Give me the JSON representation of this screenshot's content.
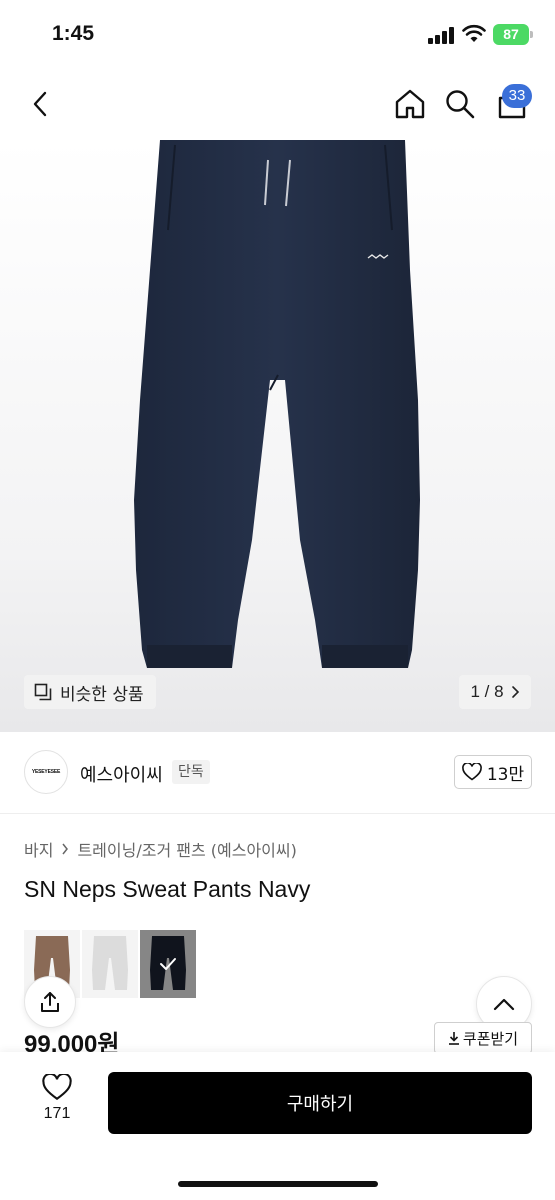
{
  "status_bar": {
    "time": "1:45",
    "battery": "87"
  },
  "nav": {
    "back_icon": "chevron-left-icon",
    "home_icon": "home-icon",
    "search_icon": "search-icon",
    "cart_icon": "shopping-bag-icon",
    "cart_count": "33"
  },
  "gallery": {
    "similar_label": "비슷한 상품",
    "pager": "1 / 8"
  },
  "brand": {
    "logo_text": "YESEYESEE",
    "name": "예스아이씨",
    "badge": "단독",
    "likes": "13만"
  },
  "breadcrumb": {
    "level1": "바지",
    "level2": "트레이닝/조거 팬츠 (예스아이씨)"
  },
  "product": {
    "title": "SN Neps Sweat Pants Navy",
    "price": "99,000원",
    "coupon_label": "쿠폰받기"
  },
  "swatches": [
    {
      "color": "#8a6a56",
      "selected": false
    },
    {
      "color": "#dcdcdc",
      "selected": false
    },
    {
      "color": "#1e2536",
      "selected": true
    }
  ],
  "bottom_bar": {
    "wish_count": "171",
    "buy_label": "구매하기"
  },
  "colors": {
    "accent_badge": "#3a6fd8",
    "buy_button": "#000000",
    "pants_navy": "#243049"
  }
}
